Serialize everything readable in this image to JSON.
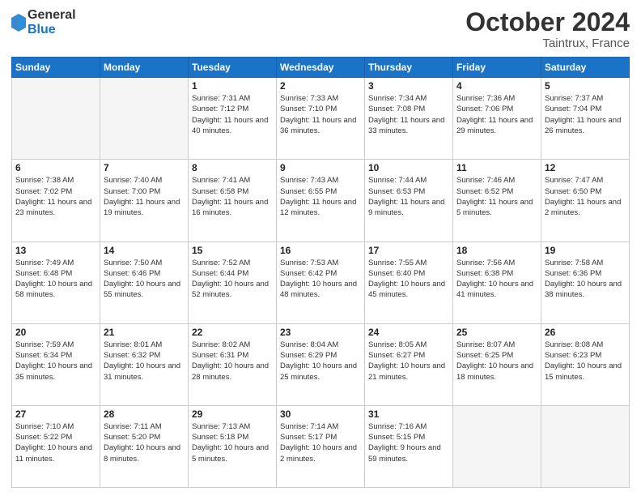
{
  "header": {
    "logo_general": "General",
    "logo_blue": "Blue",
    "month_title": "October 2024",
    "location": "Taintrux, France"
  },
  "days_of_week": [
    "Sunday",
    "Monday",
    "Tuesday",
    "Wednesday",
    "Thursday",
    "Friday",
    "Saturday"
  ],
  "weeks": [
    [
      {
        "day": "",
        "info": ""
      },
      {
        "day": "",
        "info": ""
      },
      {
        "day": "1",
        "info": "Sunrise: 7:31 AM\nSunset: 7:12 PM\nDaylight: 11 hours\nand 40 minutes."
      },
      {
        "day": "2",
        "info": "Sunrise: 7:33 AM\nSunset: 7:10 PM\nDaylight: 11 hours\nand 36 minutes."
      },
      {
        "day": "3",
        "info": "Sunrise: 7:34 AM\nSunset: 7:08 PM\nDaylight: 11 hours\nand 33 minutes."
      },
      {
        "day": "4",
        "info": "Sunrise: 7:36 AM\nSunset: 7:06 PM\nDaylight: 11 hours\nand 29 minutes."
      },
      {
        "day": "5",
        "info": "Sunrise: 7:37 AM\nSunset: 7:04 PM\nDaylight: 11 hours\nand 26 minutes."
      }
    ],
    [
      {
        "day": "6",
        "info": "Sunrise: 7:38 AM\nSunset: 7:02 PM\nDaylight: 11 hours\nand 23 minutes."
      },
      {
        "day": "7",
        "info": "Sunrise: 7:40 AM\nSunset: 7:00 PM\nDaylight: 11 hours\nand 19 minutes."
      },
      {
        "day": "8",
        "info": "Sunrise: 7:41 AM\nSunset: 6:58 PM\nDaylight: 11 hours\nand 16 minutes."
      },
      {
        "day": "9",
        "info": "Sunrise: 7:43 AM\nSunset: 6:55 PM\nDaylight: 11 hours\nand 12 minutes."
      },
      {
        "day": "10",
        "info": "Sunrise: 7:44 AM\nSunset: 6:53 PM\nDaylight: 11 hours\nand 9 minutes."
      },
      {
        "day": "11",
        "info": "Sunrise: 7:46 AM\nSunset: 6:52 PM\nDaylight: 11 hours\nand 5 minutes."
      },
      {
        "day": "12",
        "info": "Sunrise: 7:47 AM\nSunset: 6:50 PM\nDaylight: 11 hours\nand 2 minutes."
      }
    ],
    [
      {
        "day": "13",
        "info": "Sunrise: 7:49 AM\nSunset: 6:48 PM\nDaylight: 10 hours\nand 58 minutes."
      },
      {
        "day": "14",
        "info": "Sunrise: 7:50 AM\nSunset: 6:46 PM\nDaylight: 10 hours\nand 55 minutes."
      },
      {
        "day": "15",
        "info": "Sunrise: 7:52 AM\nSunset: 6:44 PM\nDaylight: 10 hours\nand 52 minutes."
      },
      {
        "day": "16",
        "info": "Sunrise: 7:53 AM\nSunset: 6:42 PM\nDaylight: 10 hours\nand 48 minutes."
      },
      {
        "day": "17",
        "info": "Sunrise: 7:55 AM\nSunset: 6:40 PM\nDaylight: 10 hours\nand 45 minutes."
      },
      {
        "day": "18",
        "info": "Sunrise: 7:56 AM\nSunset: 6:38 PM\nDaylight: 10 hours\nand 41 minutes."
      },
      {
        "day": "19",
        "info": "Sunrise: 7:58 AM\nSunset: 6:36 PM\nDaylight: 10 hours\nand 38 minutes."
      }
    ],
    [
      {
        "day": "20",
        "info": "Sunrise: 7:59 AM\nSunset: 6:34 PM\nDaylight: 10 hours\nand 35 minutes."
      },
      {
        "day": "21",
        "info": "Sunrise: 8:01 AM\nSunset: 6:32 PM\nDaylight: 10 hours\nand 31 minutes."
      },
      {
        "day": "22",
        "info": "Sunrise: 8:02 AM\nSunset: 6:31 PM\nDaylight: 10 hours\nand 28 minutes."
      },
      {
        "day": "23",
        "info": "Sunrise: 8:04 AM\nSunset: 6:29 PM\nDaylight: 10 hours\nand 25 minutes."
      },
      {
        "day": "24",
        "info": "Sunrise: 8:05 AM\nSunset: 6:27 PM\nDaylight: 10 hours\nand 21 minutes."
      },
      {
        "day": "25",
        "info": "Sunrise: 8:07 AM\nSunset: 6:25 PM\nDaylight: 10 hours\nand 18 minutes."
      },
      {
        "day": "26",
        "info": "Sunrise: 8:08 AM\nSunset: 6:23 PM\nDaylight: 10 hours\nand 15 minutes."
      }
    ],
    [
      {
        "day": "27",
        "info": "Sunrise: 7:10 AM\nSunset: 5:22 PM\nDaylight: 10 hours\nand 11 minutes."
      },
      {
        "day": "28",
        "info": "Sunrise: 7:11 AM\nSunset: 5:20 PM\nDaylight: 10 hours\nand 8 minutes."
      },
      {
        "day": "29",
        "info": "Sunrise: 7:13 AM\nSunset: 5:18 PM\nDaylight: 10 hours\nand 5 minutes."
      },
      {
        "day": "30",
        "info": "Sunrise: 7:14 AM\nSunset: 5:17 PM\nDaylight: 10 hours\nand 2 minutes."
      },
      {
        "day": "31",
        "info": "Sunrise: 7:16 AM\nSunset: 5:15 PM\nDaylight: 9 hours\nand 59 minutes."
      },
      {
        "day": "",
        "info": ""
      },
      {
        "day": "",
        "info": ""
      }
    ]
  ]
}
